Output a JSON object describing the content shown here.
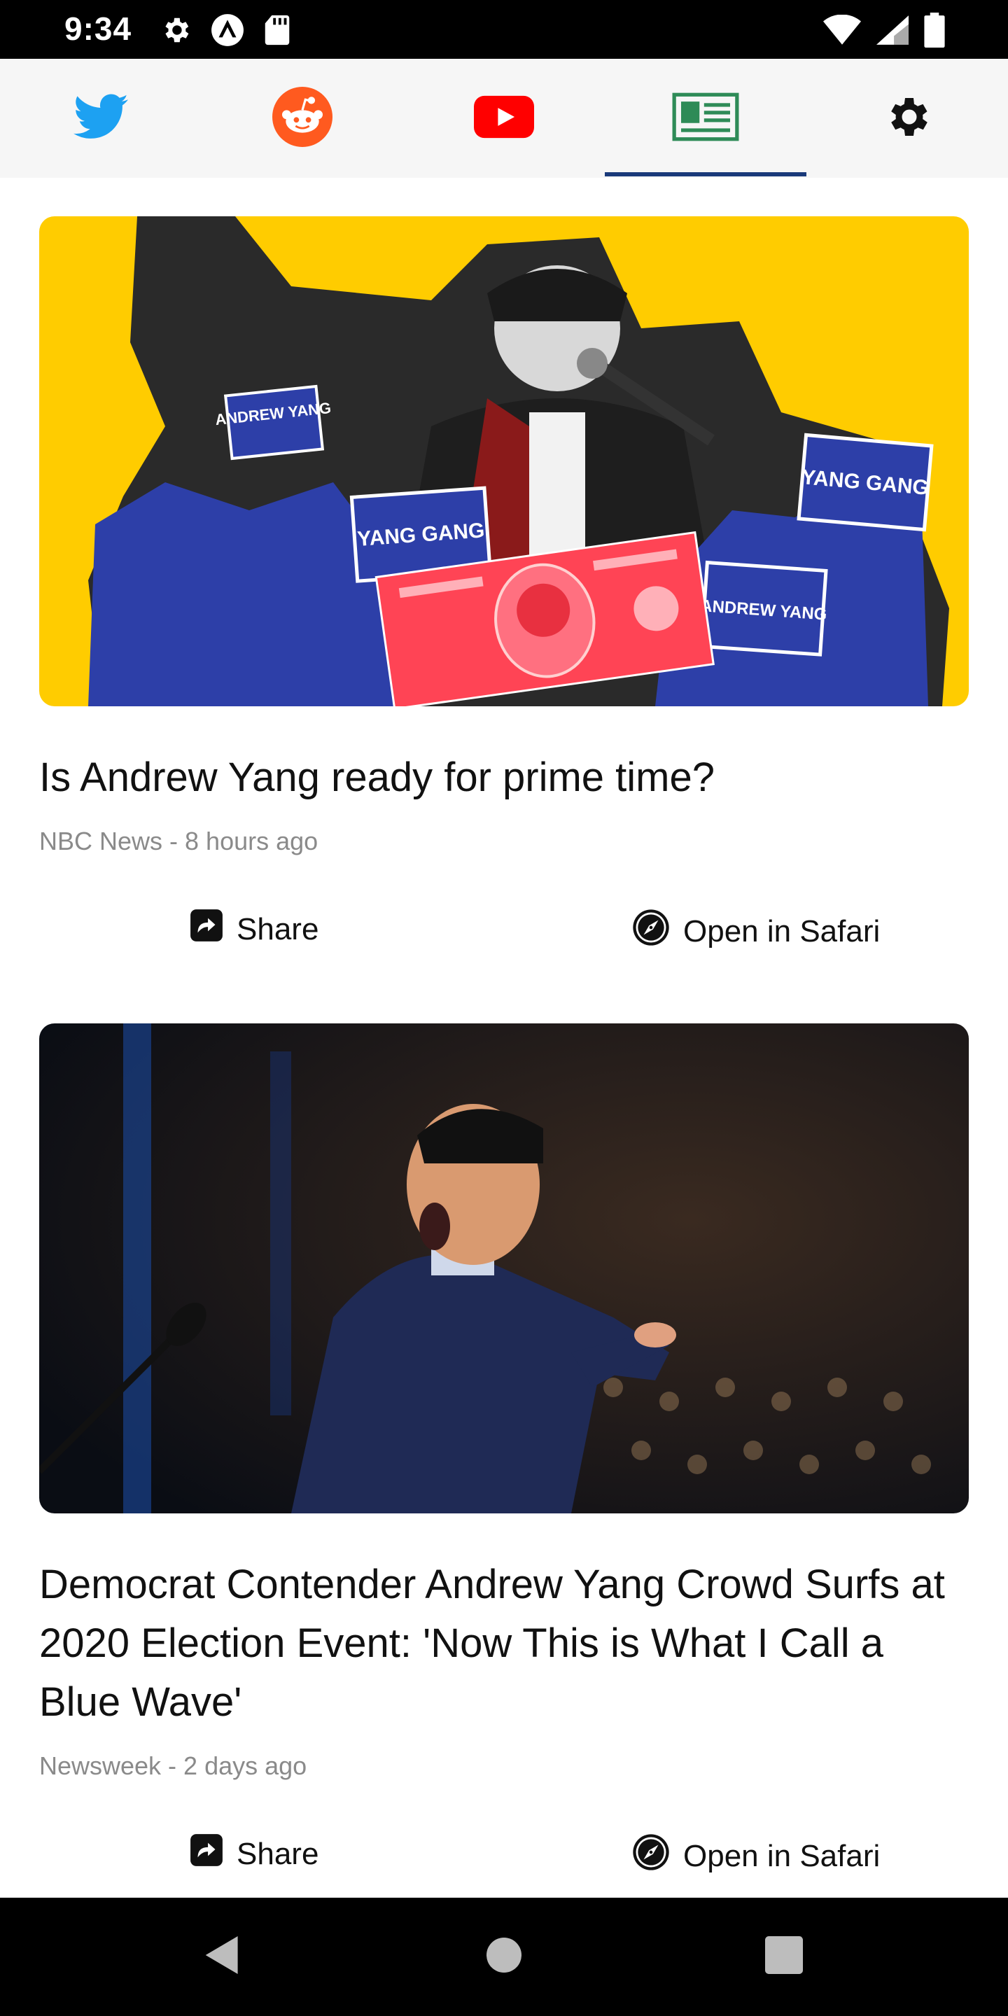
{
  "status_bar": {
    "time": "9:34",
    "left_icons": [
      "gear-icon",
      "warning-icon",
      "sd-card-icon"
    ],
    "right_icons": [
      "wifi-icon",
      "signal-icon",
      "battery-icon"
    ]
  },
  "tabs": [
    {
      "name": "twitter",
      "icon": "twitter-bird-icon",
      "color": "#1da1f2",
      "active": false
    },
    {
      "name": "reddit",
      "icon": "reddit-icon",
      "color": "#ff5a1f",
      "active": false
    },
    {
      "name": "youtube",
      "icon": "youtube-icon",
      "color": "#ff0000",
      "active": false
    },
    {
      "name": "news",
      "icon": "newspaper-icon",
      "color": "#2e8b57",
      "active": true
    },
    {
      "name": "settings",
      "icon": "gear-icon",
      "color": "#111111",
      "active": false
    }
  ],
  "articles": [
    {
      "title": "Is Andrew Yang ready for prime time?",
      "meta": "NBC News - 8 hours ago",
      "share_label": "Share",
      "safari_label": "Open in Safari",
      "image_signs": [
        "YANG GANG",
        "YANG GANG",
        "ANDREW YANG",
        "ANDREW YANG"
      ]
    },
    {
      "title": "Democrat Contender Andrew Yang Crowd Surfs at 2020 Election Event: 'Now This is What I Call a Blue Wave'",
      "meta": "Newsweek - 2 days ago",
      "share_label": "Share",
      "safari_label": "Open in Safari"
    }
  ],
  "colors": {
    "accent": "#1a3a7a",
    "yellow": "#ffcc00",
    "blue": "#2d3fa8",
    "red": "#ff3344"
  }
}
